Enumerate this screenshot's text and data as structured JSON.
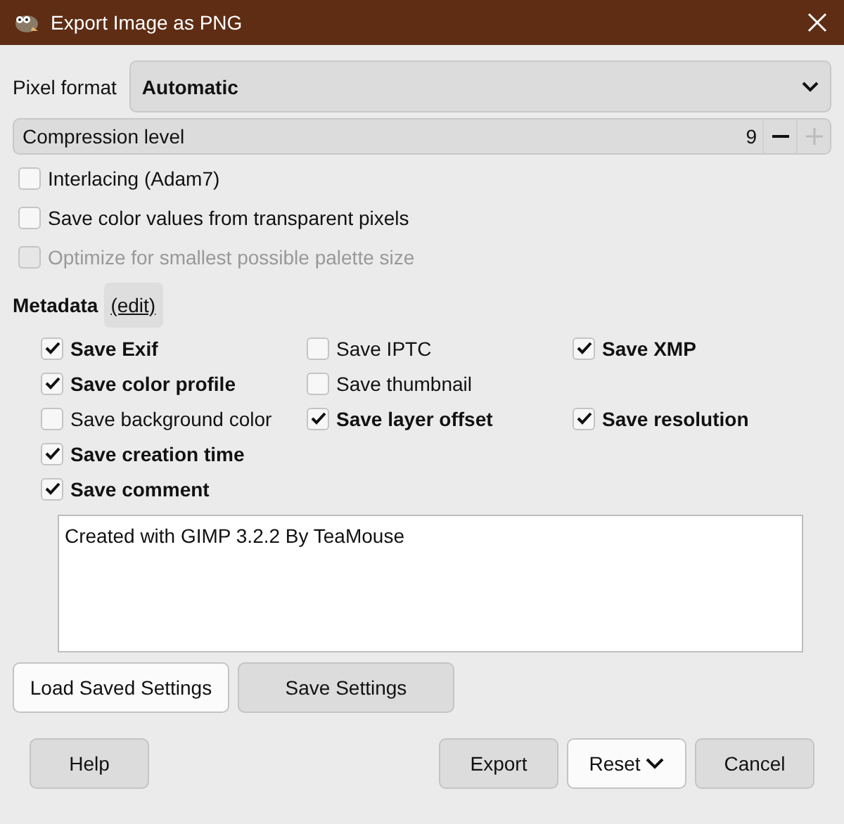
{
  "window": {
    "title": "Export Image as PNG"
  },
  "pixel_format": {
    "label": "Pixel format",
    "value": "Automatic"
  },
  "compression": {
    "label": "Compression level",
    "reading": "9"
  },
  "options": [
    {
      "label": "Interlacing (Adam7)",
      "checked": false,
      "disabled": false
    },
    {
      "label": "Save color values from transparent pixels",
      "checked": false,
      "disabled": false
    },
    {
      "label": "Optimize for smallest possible palette size",
      "checked": false,
      "disabled": true
    }
  ],
  "metadata": {
    "title": "Metadata",
    "edit_link": "(edit)",
    "rows": [
      [
        {
          "label": "Save Exif",
          "checked": true
        },
        {
          "label": "Save IPTC",
          "checked": false
        },
        {
          "label": "Save XMP",
          "checked": true
        }
      ],
      [
        {
          "label": "Save color profile",
          "checked": true
        },
        {
          "label": "Save thumbnail",
          "checked": false
        }
      ],
      [
        {
          "label": "Save background color",
          "checked": false
        },
        {
          "label": "Save layer offset",
          "checked": true
        },
        {
          "label": "Save resolution",
          "checked": true
        }
      ],
      [
        {
          "label": "Save creation time",
          "checked": true
        }
      ],
      [
        {
          "label": "Save comment",
          "checked": true
        }
      ]
    ],
    "comment": "Created with GIMP 3.2.2 By TeaMouse"
  },
  "settings_buttons": [
    {
      "label": "Load Saved Settings",
      "selected": true
    },
    {
      "label": "Save Settings",
      "selected": false
    }
  ],
  "help_button": "Help",
  "action_buttons": [
    {
      "label": "Export",
      "kind": "plain"
    },
    {
      "label": "Reset",
      "kind": "menu"
    },
    {
      "label": "Cancel",
      "kind": "plain"
    }
  ]
}
